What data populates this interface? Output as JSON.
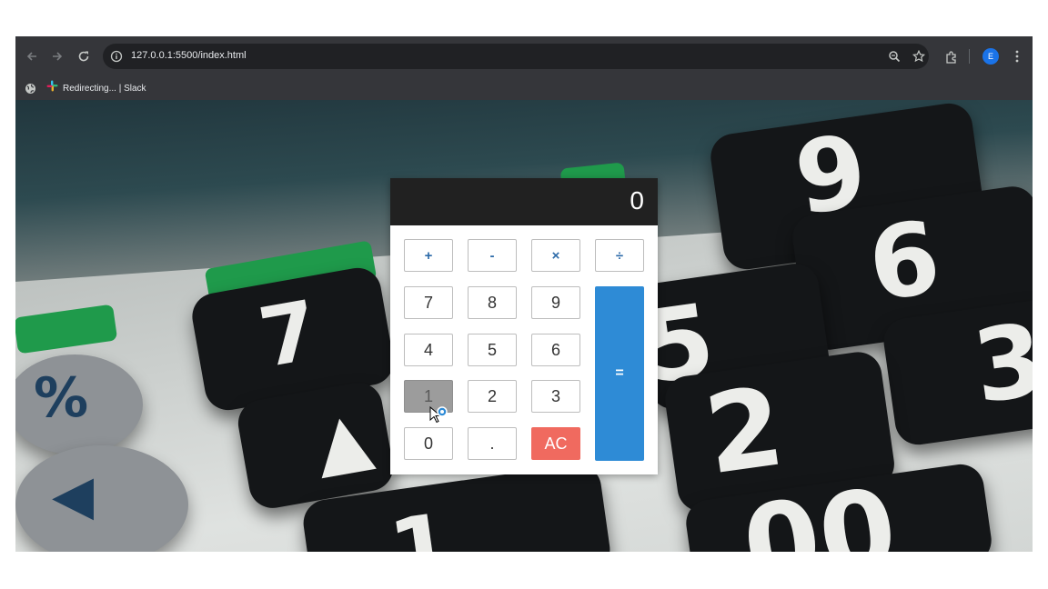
{
  "browser": {
    "url": "127.0.0.1:5500/index.html",
    "bookmarks": [
      {
        "label": "Redirecting... | Slack"
      }
    ],
    "profile_initial": "E",
    "icons": [
      "back-arrow-icon",
      "forward-arrow-icon",
      "reload-icon",
      "site-info-icon",
      "zoom-icon",
      "star-icon",
      "extensions-icon",
      "menu-icon",
      "globe-icon",
      "slack-icon"
    ]
  },
  "calculator": {
    "display": "0",
    "buttons": {
      "add": "+",
      "subtract": "-",
      "multiply": "×",
      "divide": "÷",
      "seven": "7",
      "eight": "8",
      "nine": "9",
      "four": "4",
      "five": "5",
      "six": "6",
      "one": "1",
      "two": "2",
      "three": "3",
      "zero": "0",
      "decimal": ".",
      "clear": "AC",
      "equals": "="
    },
    "colors": {
      "display_bg": "#212121",
      "equals_bg": "#2e8bd6",
      "clear_bg": "#f06a5f",
      "hover_bg": "#9c9c9c"
    }
  }
}
